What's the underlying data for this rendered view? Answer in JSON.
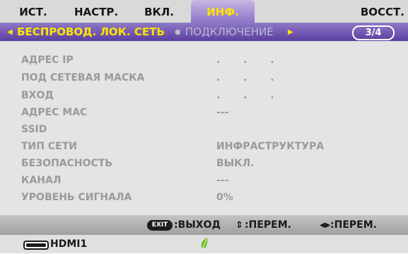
{
  "tabs": [
    "ИСТ.",
    "НАСТР.",
    "ВКЛ.",
    "ИНФ.",
    "ВОССТ."
  ],
  "active_tab": "ИНФ.",
  "submenu": {
    "active": "БЕСПРОВОД. ЛОК. СЕТЬ",
    "inactive": "ПОДКЛЮЧЕНИЕ",
    "page": "3/4"
  },
  "info": {
    "ip_label": "АДРЕС IP",
    "ip_value": ". . .",
    "subnet_label": "ПОД СЕТЕВАЯ МАСКА",
    "subnet_value": ". . .",
    "gateway_label": "ВХОД",
    "gateway_value": ". . .",
    "mac_label": "АДРЕС МАС",
    "mac_value": "---",
    "ssid_label": "SSID",
    "ssid_value": "",
    "network_type_label": "ТИП СЕТИ",
    "network_type_value": "ИНФРАСТРУКТУРА",
    "security_label": "БЕЗОПАСНОСТЬ",
    "security_value": "ВЫКЛ.",
    "channel_label": "КАНАЛ",
    "channel_value": "---",
    "signal_label": "УРОВЕНЬ СИГНАЛА",
    "signal_value": "0%"
  },
  "guide": {
    "exit_key": "EXIT",
    "exit_label": ":ВЫХОД",
    "updown_label": ":ПЕРЕМ.",
    "leftright_label": ":ПЕРЕМ."
  },
  "status": {
    "source": "HDMI1"
  },
  "colors": {
    "accent": "#ffe400",
    "submenu_bar": "#6b4fb0",
    "panel_bg": "#e4e4e4",
    "disabled_text": "#9a9a9a",
    "eco_leaf": "#6fbf1f"
  },
  "icons": {
    "hdmi": "hdmi-connector-icon",
    "eco": "eco-leaf-icon",
    "updown": "up-down-arrows-icon",
    "leftright": "left-right-arrows-icon"
  }
}
